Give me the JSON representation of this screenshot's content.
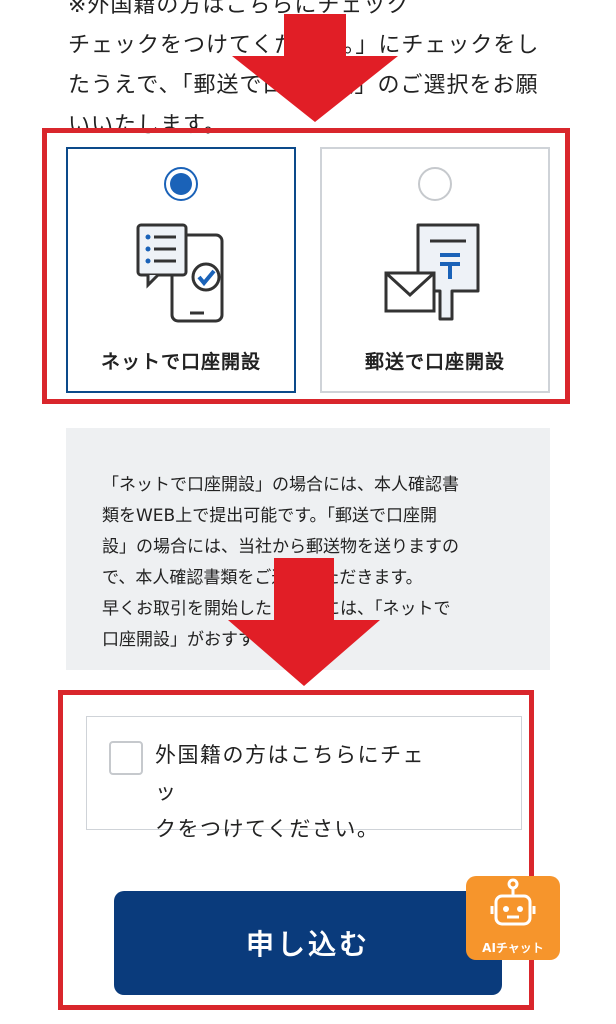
{
  "intro_text": {
    "line1": "※外国籍の方はこちらにチェック",
    "line2": "チェックをつけてください。」にチェックをし",
    "line3": "たうえで、「郵送で口座開設」のご選択をお願",
    "line4": "いいたします。"
  },
  "options": {
    "net": {
      "label": "ネットで口座開設",
      "selected": true,
      "icon": "phone-checklist-icon"
    },
    "mail": {
      "label": "郵送で口座開設",
      "selected": false,
      "icon": "envelope-post-icon"
    }
  },
  "info": {
    "line1": "「ネットで口座開設」の場合には、本人確認書",
    "line2": "類をWEB上で提出可能です。「郵送で口座開",
    "line3": "設」の場合には、当社から郵送物を送りますの",
    "line4": "で、本人確認書類をご返送いただきます。",
    "line5": "早くお取引を開始したい場合には、「ネットで",
    "line6": "口座開設」がおすすめです。"
  },
  "foreign_check": {
    "line1": "外国籍の方はこちらにチェッ",
    "line2": "クをつけてください。",
    "checked": false
  },
  "apply_button": {
    "label": "申し込む"
  },
  "ai_chat": {
    "label": "AIチャット",
    "icon": "robot-icon"
  },
  "colors": {
    "highlight_red": "#d9262c",
    "arrow_red": "#e11e26",
    "brand_navy": "#0a3b7c",
    "radio_blue": "#1a62b8",
    "ai_orange": "#f6952c"
  }
}
